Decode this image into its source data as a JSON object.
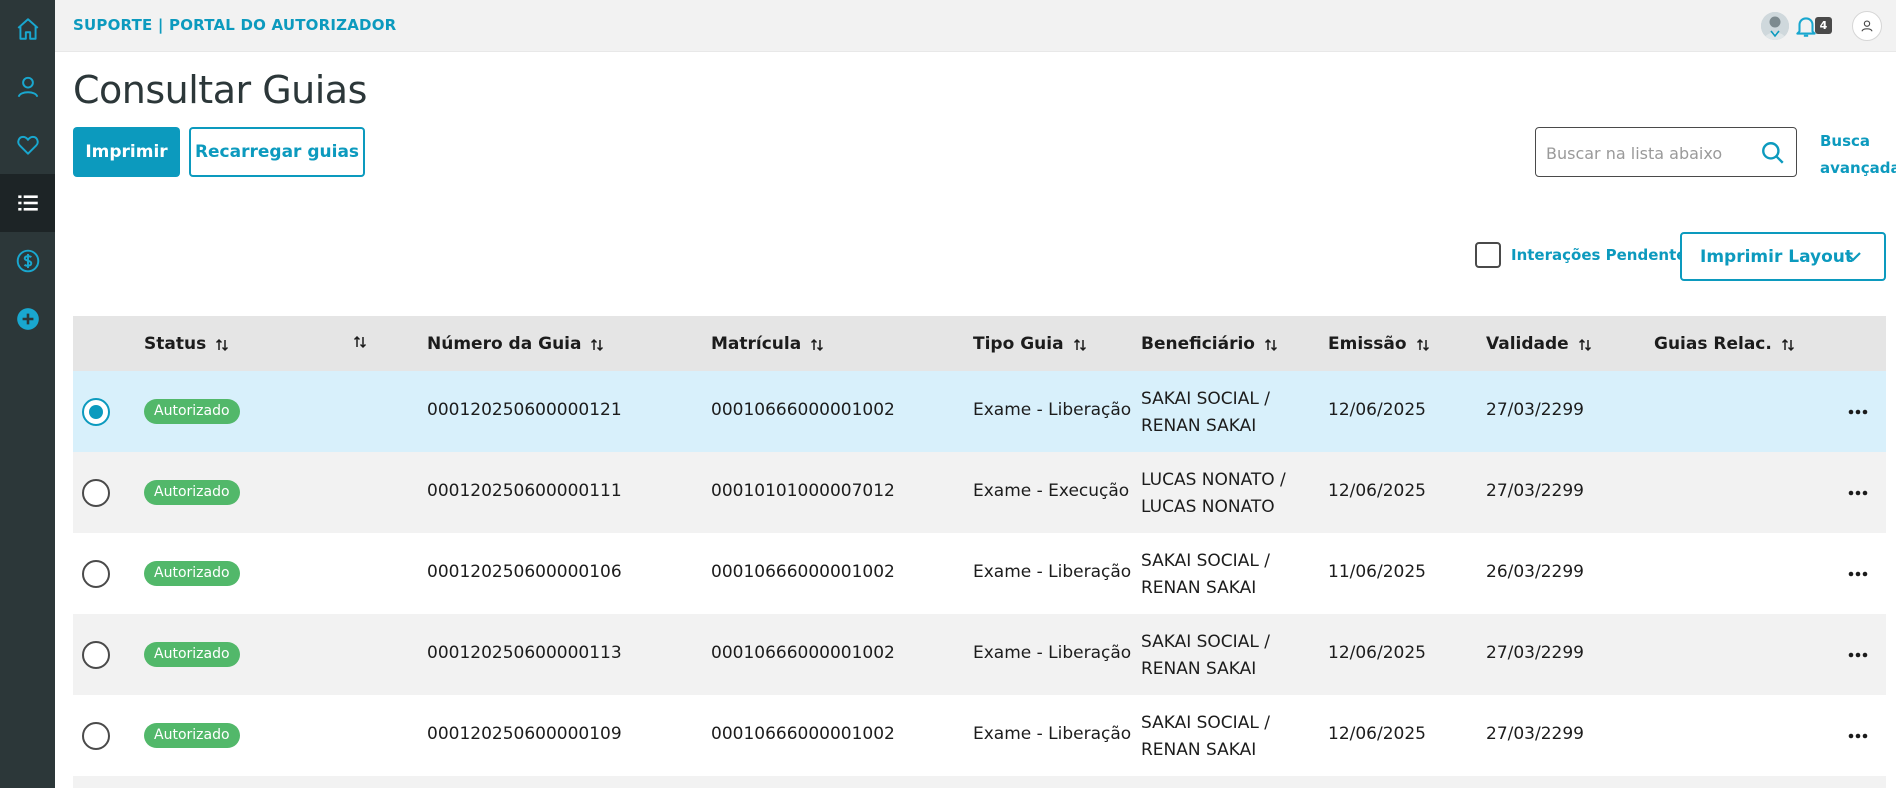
{
  "header": {
    "brand": "SUPORTE | PORTAL DO AUTORIZADOR",
    "notification_count": "4"
  },
  "sidebar": {
    "items": [
      {
        "icon": "home-icon"
      },
      {
        "icon": "user-icon"
      },
      {
        "icon": "heart-icon"
      },
      {
        "icon": "list-icon",
        "active": true
      },
      {
        "icon": "dollar-icon"
      },
      {
        "icon": "plus-icon"
      }
    ]
  },
  "page": {
    "title": "Consultar Guias",
    "print_label": "Imprimir",
    "reload_label": "Recarregar guias",
    "search_placeholder": "Buscar na lista abaixo",
    "advanced_search_line1": "Busca",
    "advanced_search_line2": "avançada",
    "pending_label": "Interações Pendentes",
    "layout_label": "Imprimir Layout"
  },
  "table": {
    "columns": [
      "Status",
      "",
      "Número da Guia",
      "Matrícula",
      "Tipo Guia",
      "Beneficiário",
      "Emissão",
      "Validade",
      "Guias Relac."
    ],
    "rows": [
      {
        "status": "Autorizado",
        "numero": "000120250600000121",
        "matricula": "00010666000001002",
        "tipo": "Exame - Liberação",
        "benef1": "SAKAI SOCIAL /",
        "benef2": "RENAN SAKAI",
        "emissao": "12/06/2025",
        "validade": "27/03/2299",
        "selected": true
      },
      {
        "status": "Autorizado",
        "numero": "000120250600000111",
        "matricula": "00010101000007012",
        "tipo": "Exame - Execução",
        "benef1": "LUCAS NONATO /",
        "benef2": "LUCAS NONATO",
        "emissao": "12/06/2025",
        "validade": "27/03/2299"
      },
      {
        "status": "Autorizado",
        "numero": "000120250600000106",
        "matricula": "00010666000001002",
        "tipo": "Exame - Liberação",
        "benef1": "SAKAI SOCIAL /",
        "benef2": "RENAN SAKAI",
        "emissao": "11/06/2025",
        "validade": "26/03/2299"
      },
      {
        "status": "Autorizado",
        "numero": "000120250600000113",
        "matricula": "00010666000001002",
        "tipo": "Exame - Liberação",
        "benef1": "SAKAI SOCIAL /",
        "benef2": "RENAN SAKAI",
        "emissao": "12/06/2025",
        "validade": "27/03/2299"
      },
      {
        "status": "Autorizado",
        "numero": "000120250600000109",
        "matricula": "00010666000001002",
        "tipo": "Exame - Liberação",
        "benef1": "SAKAI SOCIAL /",
        "benef2": "RENAN SAKAI",
        "emissao": "12/06/2025",
        "validade": "27/03/2299"
      }
    ]
  },
  "colors": {
    "accent": "#0c9abe",
    "sidebar": "#2c3739",
    "status_green": "#52b86a",
    "selected_row": "#d8f0fb"
  }
}
